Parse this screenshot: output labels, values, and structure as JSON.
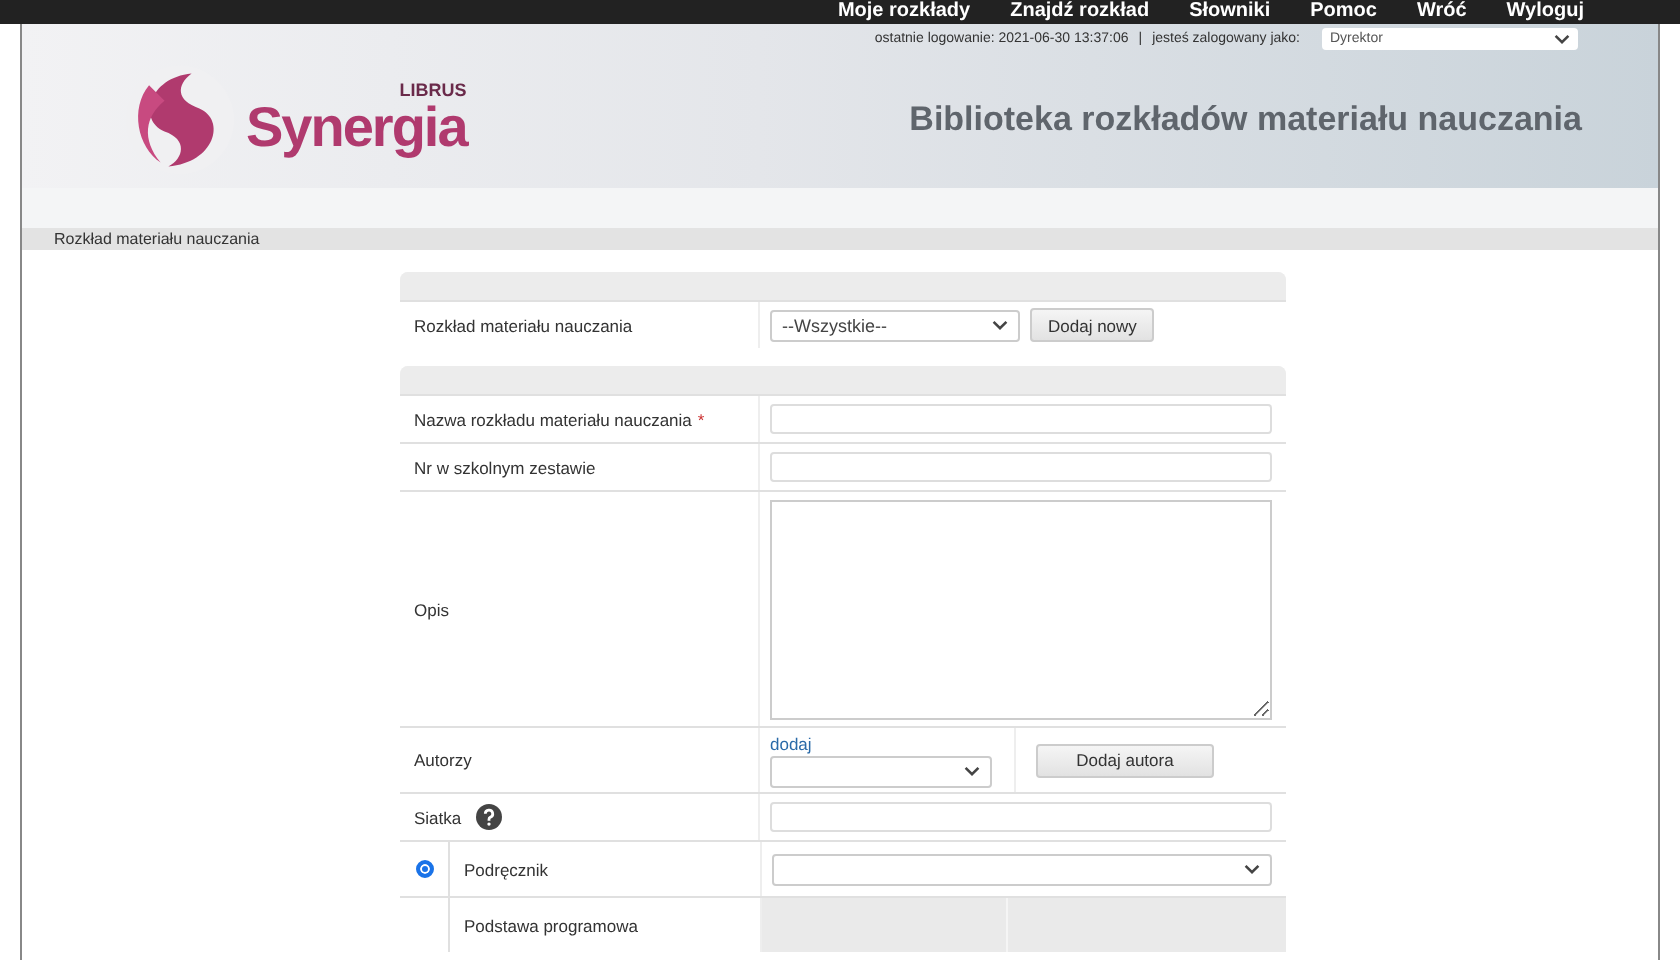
{
  "top_nav": [
    {
      "label": "Moje rozkłady"
    },
    {
      "label": "Znajdź rozkład"
    },
    {
      "label": "Słowniki"
    },
    {
      "label": "Pomoc"
    },
    {
      "label": "Wróć"
    },
    {
      "label": "Wyloguj"
    }
  ],
  "header": {
    "last_login": "ostatnie logowanie: 2021-06-30 13:37:06",
    "separator": "|",
    "logged_as": "jesteś zalogowany jako:",
    "role": "Dyrektor",
    "logo_brand": "LIBRUS",
    "logo_name": "Synergia",
    "title": "Biblioteka rozkładów materiału nauczania"
  },
  "section_title": "Rozkład materiału nauczania",
  "filter": {
    "label": "Rozkład materiału nauczania",
    "select_value": "--Wszystkie--",
    "button": "Dodaj nowy"
  },
  "form": {
    "rows": [
      {
        "kind": "text",
        "label": "Nazwa rozkładu materiału nauczania",
        "required_mark": "*"
      },
      {
        "kind": "text",
        "label": "Nr w szkolnym zestawie"
      },
      {
        "kind": "textarea",
        "label": "Opis"
      },
      {
        "kind": "authors",
        "label": "Autorzy",
        "link": "dodaj",
        "button": "Dodaj autora"
      },
      {
        "kind": "help-text",
        "label": "Siatka"
      },
      {
        "kind": "radio-select",
        "label": "Podręcznik",
        "selected": true
      },
      {
        "kind": "plain",
        "label": "Podstawa programowa"
      }
    ]
  }
}
